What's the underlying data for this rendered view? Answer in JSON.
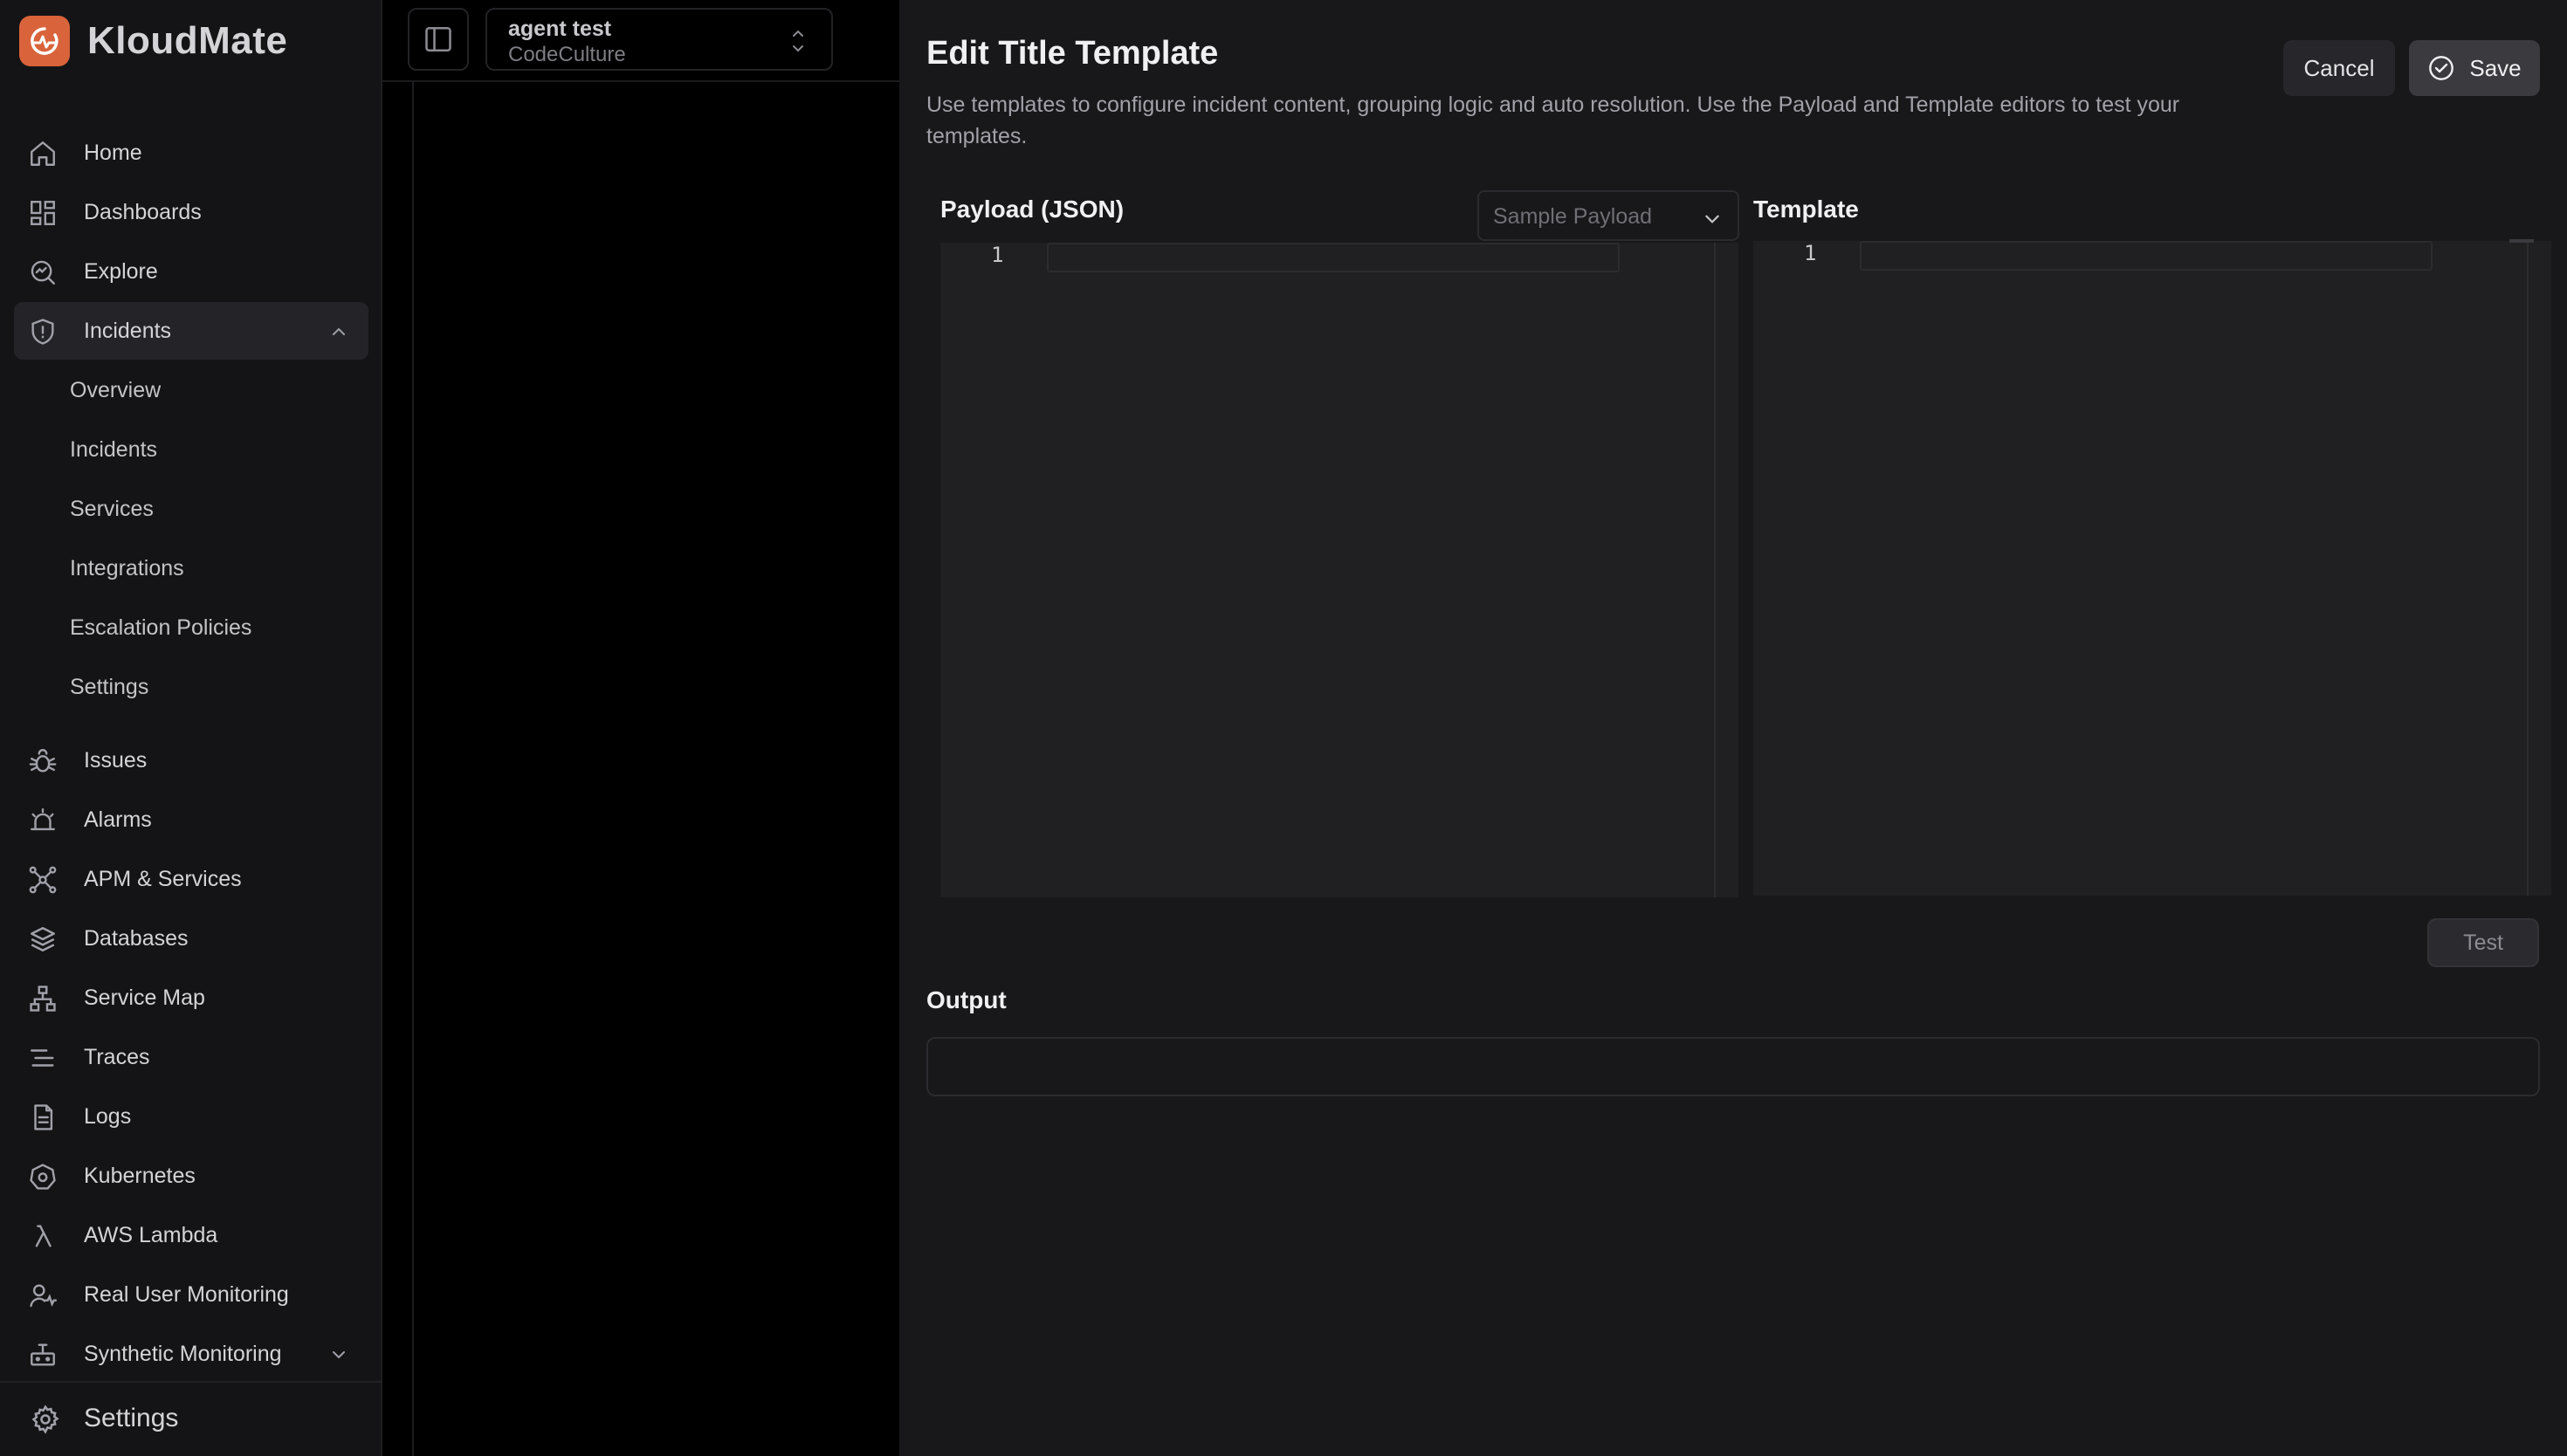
{
  "app": {
    "name": "KloudMate",
    "brand_color": "#d9633b"
  },
  "sidebar": {
    "items": [
      {
        "label": "Home",
        "icon": "home-icon"
      },
      {
        "label": "Dashboards",
        "icon": "dashboards-icon"
      },
      {
        "label": "Explore",
        "icon": "explore-icon"
      },
      {
        "label": "Incidents",
        "icon": "shield-alert-icon",
        "expanded": true
      }
    ],
    "incident_subitems": [
      "Overview",
      "Incidents",
      "Services",
      "Integrations",
      "Escalation Policies",
      "Settings"
    ],
    "items_after": [
      {
        "label": "Issues",
        "icon": "bug-icon"
      },
      {
        "label": "Alarms",
        "icon": "alarm-icon"
      },
      {
        "label": "APM & Services",
        "icon": "apm-icon"
      },
      {
        "label": "Databases",
        "icon": "database-icon"
      },
      {
        "label": "Service Map",
        "icon": "service-map-icon"
      },
      {
        "label": "Traces",
        "icon": "traces-icon"
      },
      {
        "label": "Logs",
        "icon": "logs-icon"
      },
      {
        "label": "Kubernetes",
        "icon": "kubernetes-icon"
      },
      {
        "label": "AWS Lambda",
        "icon": "lambda-icon"
      },
      {
        "label": "Real User Monitoring",
        "icon": "rum-icon"
      },
      {
        "label": "Synthetic Monitoring",
        "icon": "synthetic-icon"
      }
    ],
    "footer_label": "Settings"
  },
  "workspace": {
    "title": "agent test",
    "subtitle": "CodeCulture"
  },
  "dialog": {
    "title": "Edit Title Template",
    "description": "Use templates to configure incident content, grouping logic and auto resolution. Use the Payload and Template editors to test your templates.",
    "cancel_label": "Cancel",
    "save_label": "Save",
    "payload_label": "Payload (JSON)",
    "sample_payload_placeholder": "Sample Payload",
    "template_label": "Template",
    "payload_line_number": "1",
    "template_line_number": "1",
    "test_label": "Test",
    "output_label": "Output",
    "output_value": ""
  }
}
